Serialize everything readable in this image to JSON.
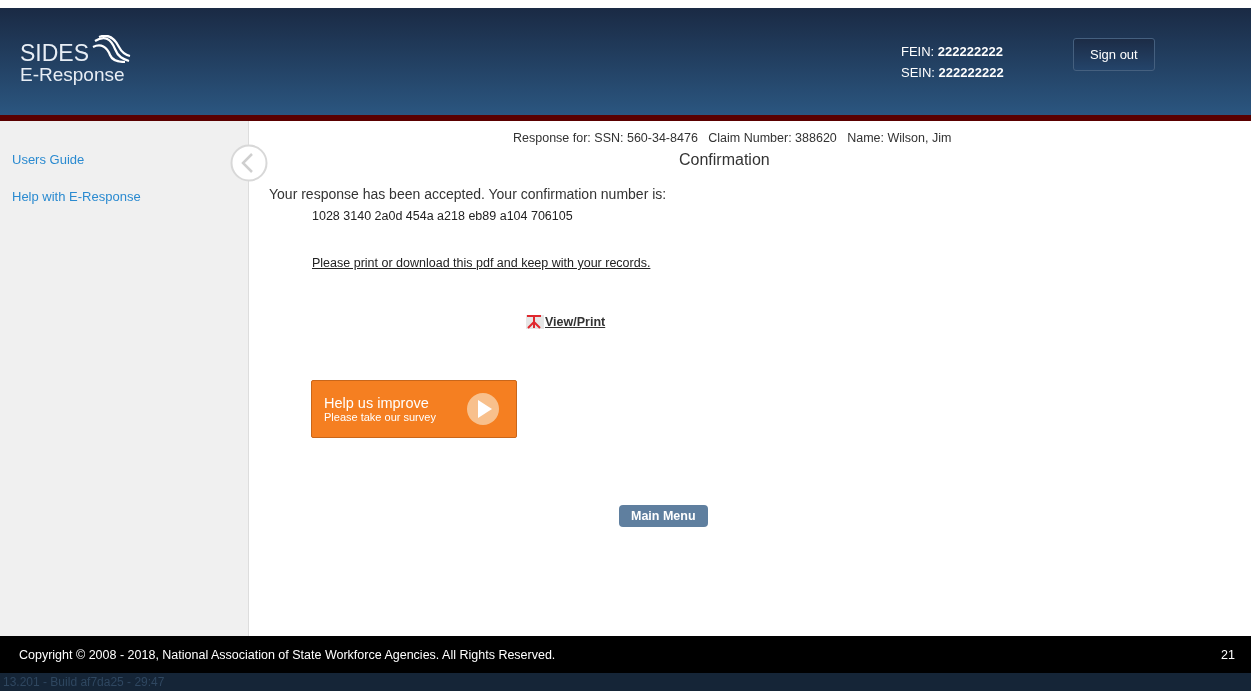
{
  "header": {
    "logo_title": "SIDES",
    "logo_subtitle": "E-Response",
    "fein_label": "FEIN:",
    "fein_value": "222222222",
    "sein_label": "SEIN:",
    "sein_value": "222222222",
    "sign_out": "Sign out"
  },
  "sidebar": {
    "items": [
      "Users Guide",
      "Help with E-Response"
    ]
  },
  "main": {
    "response_for": "Response for: SSN: 560-34-8476   Claim Number: 388620   Name: Wilson, Jim",
    "heading": "Confirmation",
    "accepted": "Your response has been accepted. Your confirmation number is:",
    "confirmation_number": "1028 3140 2a0d 454a a218 eb89 a104 706105",
    "print_note": "Please print or download this pdf and keep with your records.",
    "view_print": "View/Print",
    "survey": {
      "title": "Help us improve",
      "subtitle": "Please take our survey"
    },
    "main_menu": "Main Menu"
  },
  "footer": {
    "copyright": "Copyright © 2008 - 2018, National Association of State Workforce Agencies. All Rights Reserved.",
    "page_number": "21"
  },
  "build": "13.201 - Build af7da25 - 29:47"
}
